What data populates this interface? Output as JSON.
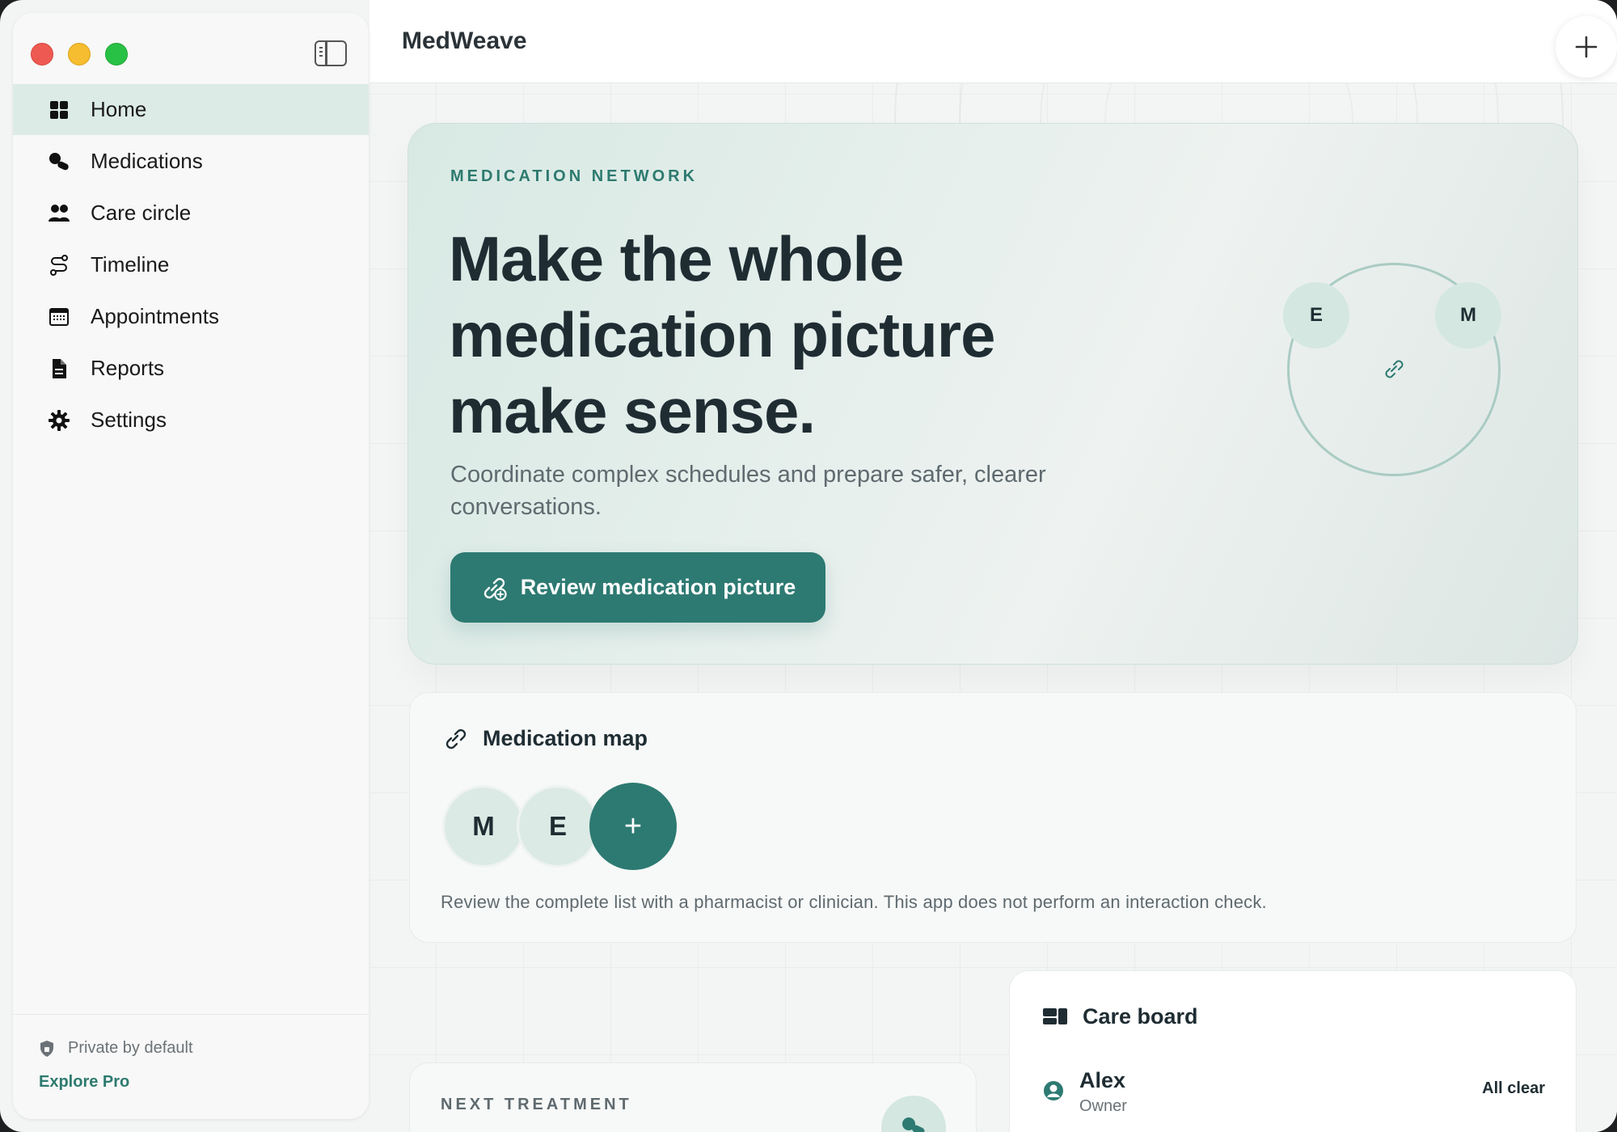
{
  "window": {
    "traffic_lights": [
      "close",
      "minimize",
      "maximize"
    ]
  },
  "sidebar": {
    "toggle_icon": "sidebar-toggle-icon",
    "items": [
      {
        "label": "Home",
        "icon": "grid-icon",
        "active": true
      },
      {
        "label": "Medications",
        "icon": "pills-icon",
        "active": false
      },
      {
        "label": "Care circle",
        "icon": "people-icon",
        "active": false
      },
      {
        "label": "Timeline",
        "icon": "route-icon",
        "active": false
      },
      {
        "label": "Appointments",
        "icon": "calendar-icon",
        "active": false
      },
      {
        "label": "Reports",
        "icon": "document-icon",
        "active": false
      },
      {
        "label": "Settings",
        "icon": "gear-icon",
        "active": false
      }
    ],
    "footer": {
      "private_label": "Private by default",
      "explore_label": "Explore Pro"
    }
  },
  "header": {
    "title": "MedWeave",
    "add_icon": "plus-icon"
  },
  "hero": {
    "eyebrow": "MEDICATION NETWORK",
    "title_line1": "Make the whole",
    "title_line2": "medication picture",
    "title_line3": "make sense.",
    "subtitle": "Coordinate complex schedules and prepare safer, clearer conversations.",
    "cta_label": "Review medication picture",
    "network_nodes": [
      "E",
      "M"
    ]
  },
  "medication_map": {
    "title": "Medication map",
    "chips": [
      "M",
      "E"
    ],
    "add_label": "+",
    "note": "Review the complete list with a pharmacist or clinician. This app does not perform an interaction check."
  },
  "next_treatment": {
    "eyebrow": "NEXT TREATMENT"
  },
  "care_board": {
    "title": "Care board",
    "members": [
      {
        "name": "Alex",
        "role": "Owner",
        "status": "All clear"
      }
    ]
  },
  "colors": {
    "accent": "#2d7a72",
    "accent_light": "#dcebe6",
    "text_primary": "#1f2d33",
    "text_secondary": "#5f6a6f"
  }
}
